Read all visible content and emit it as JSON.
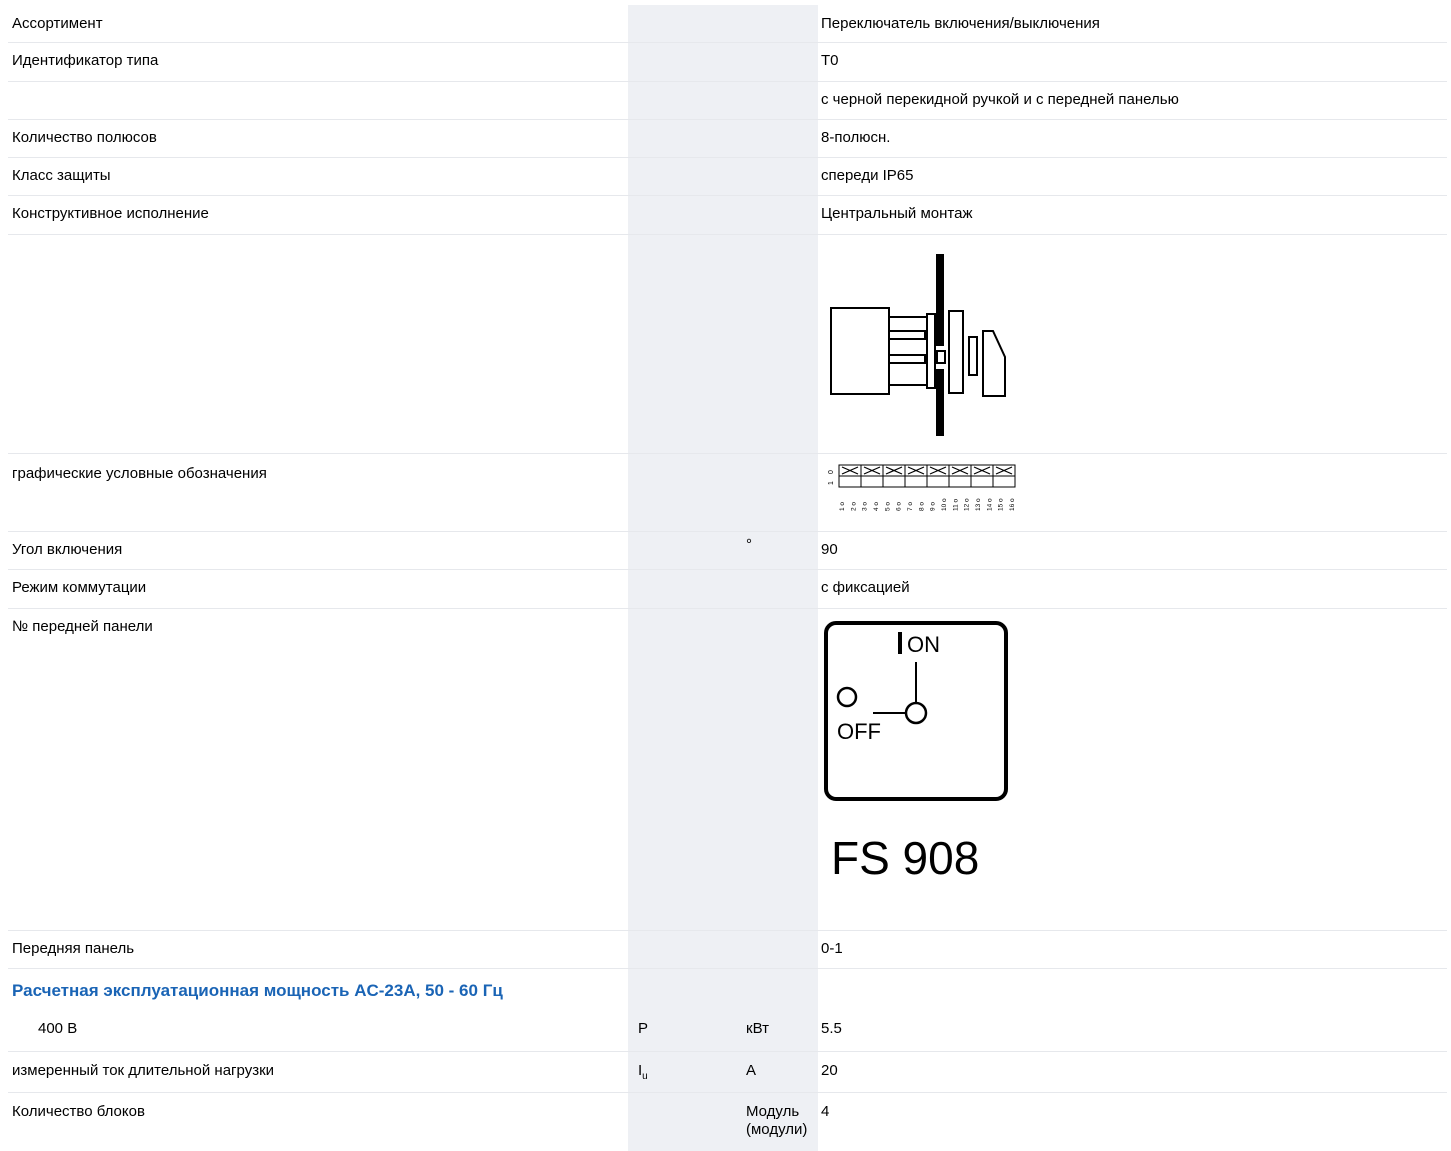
{
  "rows": {
    "assortment": {
      "label": "Ассортимент",
      "value": "Переключатель включения/выключения"
    },
    "type_id": {
      "label": "Идентификатор типа",
      "value": "T0"
    },
    "handle": {
      "value": "с черной перекидной ручкой и с передней панелью"
    },
    "poles": {
      "label": "Количество полюсов",
      "value": "8-полюсн."
    },
    "protection": {
      "label": "Класс защиты",
      "value": "спереди IP65"
    },
    "construction": {
      "label": "Конструктивное исполнение",
      "value": "Центральный монтаж"
    },
    "symbols": {
      "label": "графические условные обозначения",
      "positions": [
        "0",
        "1"
      ],
      "contacts": [
        "1",
        "2",
        "3",
        "4",
        "5",
        "6",
        "7",
        "8",
        "9",
        "10",
        "11",
        "12",
        "13",
        "14",
        "15",
        "16"
      ]
    },
    "angle": {
      "label": "Угол включения",
      "unit": "°",
      "value": "90"
    },
    "mode": {
      "label": "Режим коммутации",
      "value": "с фиксацией"
    },
    "front_plate_no": {
      "label": "№ передней панели",
      "on_text": "ON",
      "off_text": "OFF",
      "plate_code": "FS 908"
    },
    "front_plate": {
      "label": "Передняя панель",
      "value": "0-1"
    },
    "section": {
      "title": "Расчетная эксплуатационная мощность AC-23A, 50 - 60 Гц"
    },
    "power_400": {
      "label": "400 В",
      "symbol": "P",
      "unit": "кВт",
      "value": "5.5"
    },
    "current": {
      "label": "измеренный ток длительной нагрузки",
      "symbol": "I",
      "symbol_sub": "u",
      "unit": "A",
      "value": "20"
    },
    "blocks": {
      "label": "Количество блоков",
      "unit": "Модуль (модули)",
      "value": "4"
    }
  }
}
